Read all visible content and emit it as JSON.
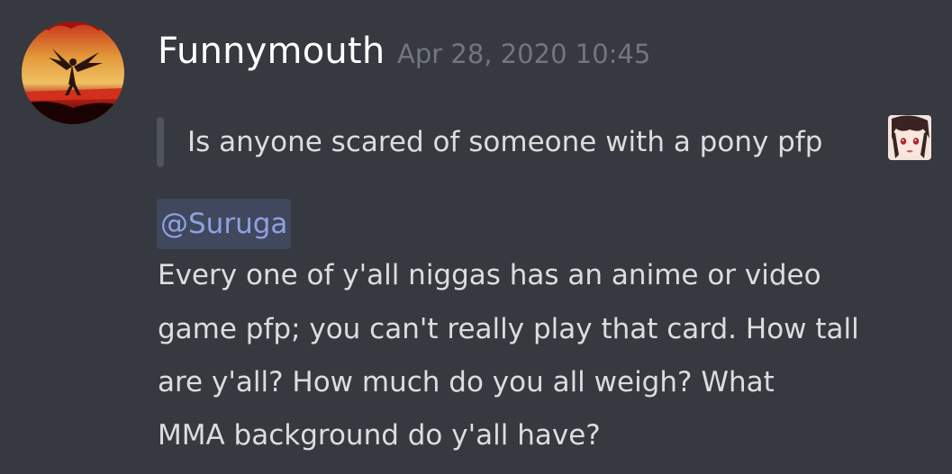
{
  "message": {
    "author": "Funnymouth",
    "timestamp": "Apr 28, 2020 10:45",
    "quote": "Is anyone scared of someone with a pony pfp",
    "quote_emoji": "anime-girl-emoji",
    "mention": "@Suruga",
    "body_lines": [
      "Every one of y'all niggas has an anime or video",
      "game pfp; you can't really play that card. How tall",
      "are y'all? How much do you all weigh? What",
      "MMA background do y'all have?"
    ]
  },
  "colors": {
    "background": "#36393f",
    "username": "#ffffff",
    "timestamp": "#72767d",
    "text": "#dcddde",
    "mention_text": "#8ea1e1",
    "mention_bg": "#41475c",
    "quote_bar": "#4f545c"
  },
  "icons": {
    "avatar": "dragon-silhouette-avatar",
    "quote_emoji": "anime-girl-emoji"
  }
}
